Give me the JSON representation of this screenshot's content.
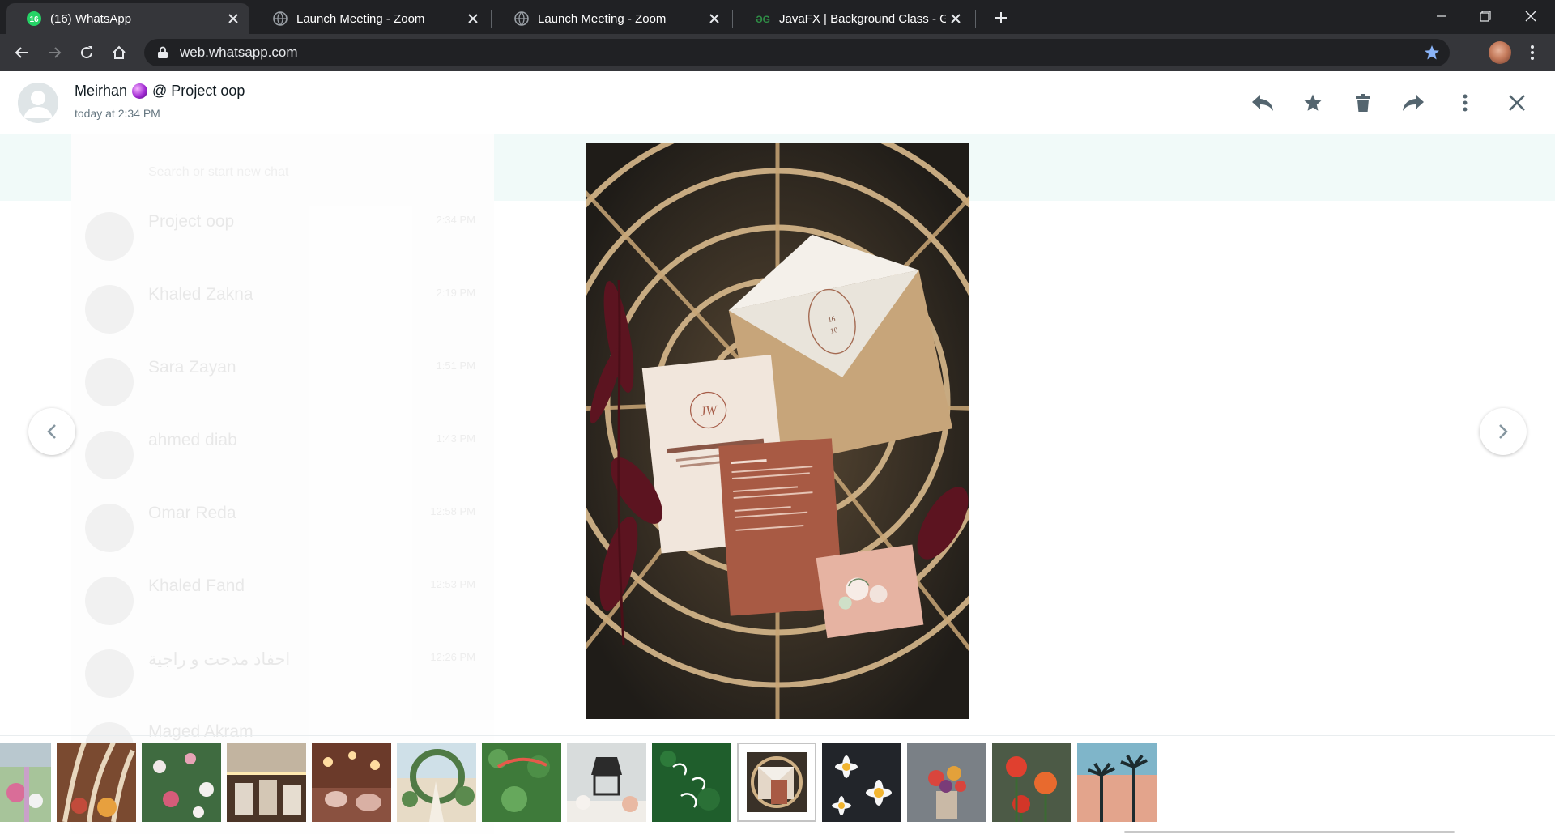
{
  "browser": {
    "tabs": [
      {
        "title": "(16) WhatsApp",
        "favicon": "whatsapp-icon",
        "active": true
      },
      {
        "title": "Launch Meeting - Zoom",
        "favicon": "globe-icon",
        "active": false
      },
      {
        "title": "Launch Meeting - Zoom",
        "favicon": "globe-icon",
        "active": false
      },
      {
        "title": "JavaFX | Background Class - GeeksforGeeks",
        "favicon": "geeksforgeeks-icon",
        "active": false
      }
    ],
    "url": "web.whatsapp.com",
    "colors": {
      "tab_strip": "#202124",
      "toolbar": "#35363a",
      "bookmark_star": "#8ab4f8",
      "whatsapp_green": "#25d366"
    }
  },
  "viewer": {
    "sender_name": "Meirhan",
    "group": "@ Project oop",
    "timestamp": "today at 2:34 PM",
    "actions": [
      {
        "name": "reply-icon"
      },
      {
        "name": "star-icon"
      },
      {
        "name": "delete-icon"
      },
      {
        "name": "forward-icon"
      },
      {
        "name": "menu-icon"
      },
      {
        "name": "close-icon"
      }
    ],
    "thumbnail_count": 14,
    "selected_thumbnail_index": 9
  },
  "background_chats": {
    "search_placeholder": "Search or start new chat",
    "items": [
      {
        "name": "Project oop",
        "time": "2:34 PM"
      },
      {
        "name": "Khaled Zakna",
        "time": "2:19 PM"
      },
      {
        "name": "Sara Zayan",
        "time": "1:51 PM"
      },
      {
        "name": "ahmed diab",
        "time": "1:43 PM"
      },
      {
        "name": "Omar Reda",
        "time": "12:58 PM"
      },
      {
        "name": "Khaled Fand",
        "time": "12:53 PM"
      },
      {
        "name": "احفاد مدحت و راجية",
        "time": "12:26 PM"
      },
      {
        "name": "Maged Akram",
        "time": ""
      }
    ]
  }
}
